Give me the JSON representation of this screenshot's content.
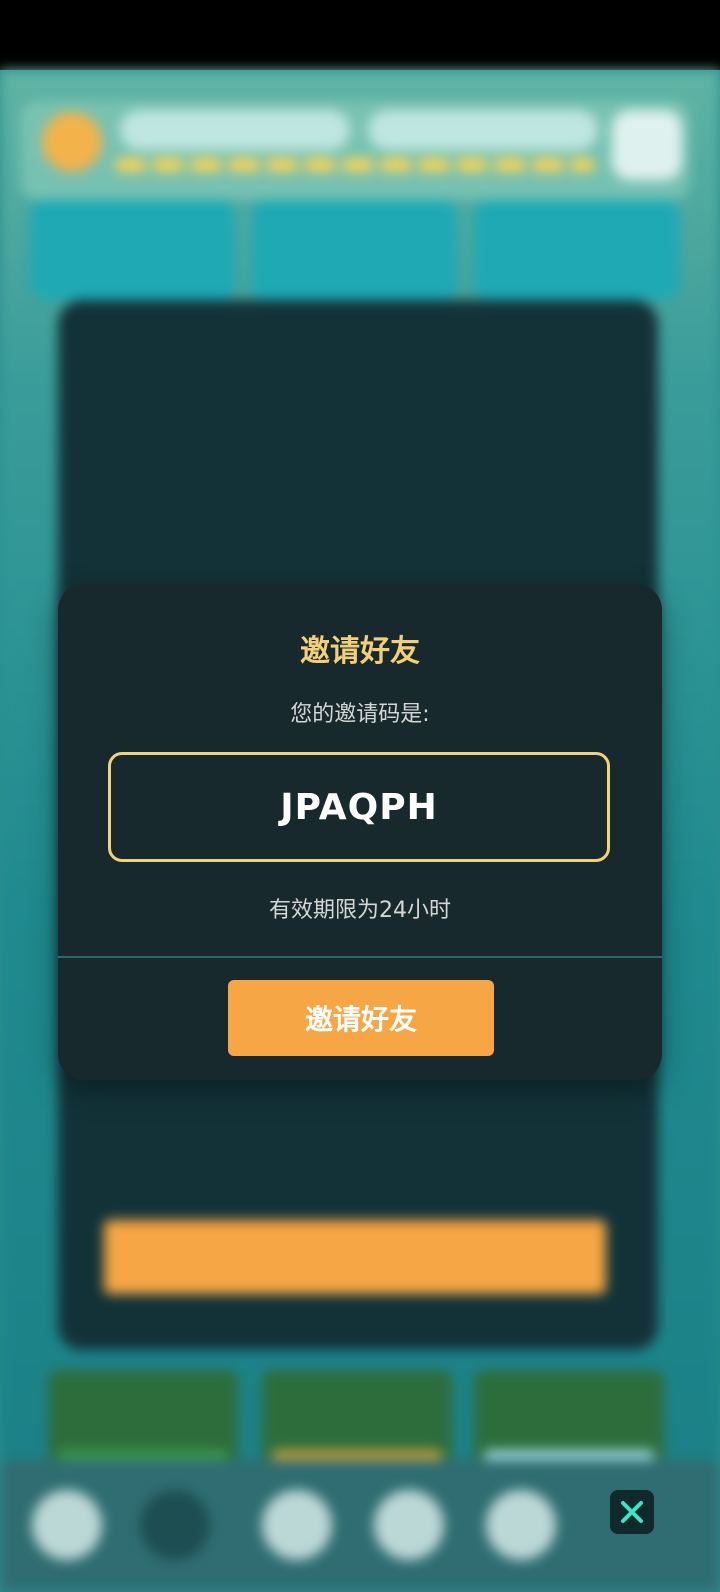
{
  "invite_dialog": {
    "title": "邀请好友",
    "subtitle": "您的邀请码是:",
    "invite_code": "JPAQPH",
    "validity_text": "有效期限为24小时",
    "invite_button_label": "邀请好友"
  },
  "colors": {
    "dialog_bg": "#17292c",
    "title": "#f3cf79",
    "code_border": "#efd27d",
    "button": "#f6a644",
    "divider": "#2b6771"
  },
  "icons": {
    "close": "close-icon"
  }
}
